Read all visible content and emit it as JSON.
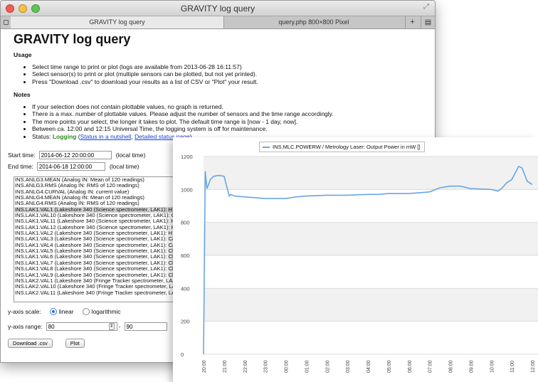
{
  "window": {
    "title": "GRAVITY log query",
    "tabs": [
      {
        "label": "GRAVITY log query"
      },
      {
        "label": "query.php 800×800 Pixel"
      }
    ],
    "new_tab_label": "+"
  },
  "page": {
    "title": "GRAVITY log query",
    "usage_heading": "Usage",
    "usage_items": [
      "Select time range to print or plot (logs are available from 2013-06-28 16:11:57)",
      "Select sensor(s) to print or plot (multiple sensors can be plotted, but not yet printed).",
      "Press \"Download .csv\" to download your results as a list of CSV or \"Plot\" your result."
    ],
    "notes_heading": "Notes",
    "notes_items": [
      "If your selection does not contain plottable values, no graph is returned.",
      "There is a max. number of plottable values. Please adjust the number of sensors and the time range accordingly.",
      "The more points your select, the longer it takes to plot. The default time range is [now - 1 day, now].",
      "Between ca. 12:00 and 12:15 Universal Time, the logging system is off for maintenance."
    ],
    "status": {
      "prefix": "Status:",
      "value": "Logging",
      "link1": "Status in a nutshell",
      "sep": ",",
      "link2": "Detailed status page"
    }
  },
  "form": {
    "start_label": "Start time:",
    "start_value": "2014-06-12 20:00:00",
    "end_label": "End time:",
    "end_value": "2014-06-18 12:00:00",
    "local_time": "(local time)",
    "sensors": [
      {
        "label": "INS.ANLG3.MEAN (Analog IN: Mean of 120 readings)",
        "selected": false
      },
      {
        "label": "INS.ANLG3.RMS (Analog IN: RMS of 120 readings)",
        "selected": false
      },
      {
        "label": "INS.ANLG4.CURVAL (Analog IN: current value)",
        "selected": false
      },
      {
        "label": "INS.ANLG4.MEAN (Analog IN: Mean of 120 readings)",
        "selected": false
      },
      {
        "label": "INS.ANLG4.RMS (Analog IN: RMS of 120 readings)",
        "selected": false
      },
      {
        "label": "INS.LAK1.VAL1 (Lakeshore 340 (Science spectrometer, LAK1): H stru",
        "selected": true
      },
      {
        "label": "INS.LAK1.VAL10 (Lakeshore 340 (Science spectrometer, LAK1): Cha",
        "selected": false
      },
      {
        "label": "INS.LAK1.VAL11 (Lakeshore 340 (Science spectrometer, LAK1): Heat",
        "selected": false
      },
      {
        "label": "INS.LAK1.VAL12 (Lakeshore 340 (Science spectrometer, LAK1): Heat",
        "selected": false
      },
      {
        "label": "INS.LAK1.VAL2 (Lakeshore 340 (Science spectrometer, LAK1): H stru",
        "selected": false
      },
      {
        "label": "INS.LAK1.VAL3 (Lakeshore 340 (Science spectrometer, LAK1): Came",
        "selected": false
      },
      {
        "label": "INS.LAK1.VAL4 (Lakeshore 340 (Science spectrometer, LAK1): Case",
        "selected": false
      },
      {
        "label": "INS.LAK1.VAL5 (Lakeshore 340 (Science spectrometer, LAK1): Chan",
        "selected": false
      },
      {
        "label": "INS.LAK1.VAL6 (Lakeshore 340 (Science spectrometer, LAK1): Chan",
        "selected": false
      },
      {
        "label": "INS.LAK1.VAL7 (Lakeshore 340 (Science spectrometer, LAK1): Chan",
        "selected": false
      },
      {
        "label": "INS.LAK1.VAL8 (Lakeshore 340 (Science spectrometer, LAK1): Chan",
        "selected": false
      },
      {
        "label": "INS.LAK1.VAL9 (Lakeshore 340 (Science spectrometer, LAK1): Chan",
        "selected": false
      },
      {
        "label": "INS.LAK2.VAL1 (Lakeshore 340 (Fringe Tracker spectrometer, LAK2)",
        "selected": false
      },
      {
        "label": "INS.LAK2.VAL10 (Lakeshore 340 (Fringe Tracker spectrometer, LAK",
        "selected": false
      },
      {
        "label": "INS.LAK2.VAL11 (Lakeshore 340 (Fringe Tracker spectrometer, LAK",
        "selected": false
      }
    ],
    "yscale_label": "y-axis scale:",
    "yscale_options": [
      "linear",
      "logarithmic"
    ],
    "yscale_selected": "linear",
    "yrange_label": "y-axis range:",
    "yrange_min": "80",
    "yrange_sep": "-",
    "yrange_max": "90",
    "download_label": "Download .csv",
    "plot_label": "Plot"
  },
  "chart_data": {
    "type": "line",
    "legend": "INS.MLC.POWERW / Metrology Laser: Output Power in mW []",
    "legend_position": "top",
    "series_color": "#69a6e3",
    "grid": true,
    "ylim": [
      0,
      1200
    ],
    "yticks": [
      0,
      200,
      400,
      600,
      800,
      1000,
      1200
    ],
    "xlim": [
      "20:00",
      "12:00"
    ],
    "xticks": [
      "20:00",
      "21:00",
      "22:00",
      "23:00",
      "00:00",
      "01:00",
      "02:00",
      "03:00",
      "04:00",
      "05:00",
      "06:00",
      "07:00",
      "08:00",
      "09:00",
      "10:00",
      "11:00",
      "12:00"
    ],
    "series": [
      {
        "x": [
          "20:00",
          "20:05",
          "20:10",
          "20:20",
          "20:30",
          "20:45",
          "21:00",
          "21:10",
          "21:15",
          "21:20",
          "21:30",
          "22:00",
          "22:30",
          "23:00",
          "23:30",
          "00:00",
          "00:30",
          "01:00",
          "02:00",
          "03:00",
          "04:00",
          "04:30",
          "05:00",
          "06:00",
          "07:00",
          "07:30",
          "08:00",
          "08:30",
          "09:00",
          "10:00",
          "10:20",
          "10:30",
          "10:45",
          "11:00",
          "11:10",
          "11:20",
          "11:30",
          "11:45",
          "12:00"
        ],
        "values": [
          0,
          1110,
          1005,
          1060,
          1080,
          1085,
          1080,
          1000,
          960,
          970,
          960,
          955,
          950,
          945,
          945,
          945,
          955,
          960,
          965,
          965,
          970,
          970,
          975,
          975,
          985,
          1010,
          1020,
          1020,
          1005,
          1000,
          990,
          1005,
          1040,
          1060,
          1100,
          1140,
          1130,
          1050,
          1030
        ]
      }
    ]
  }
}
